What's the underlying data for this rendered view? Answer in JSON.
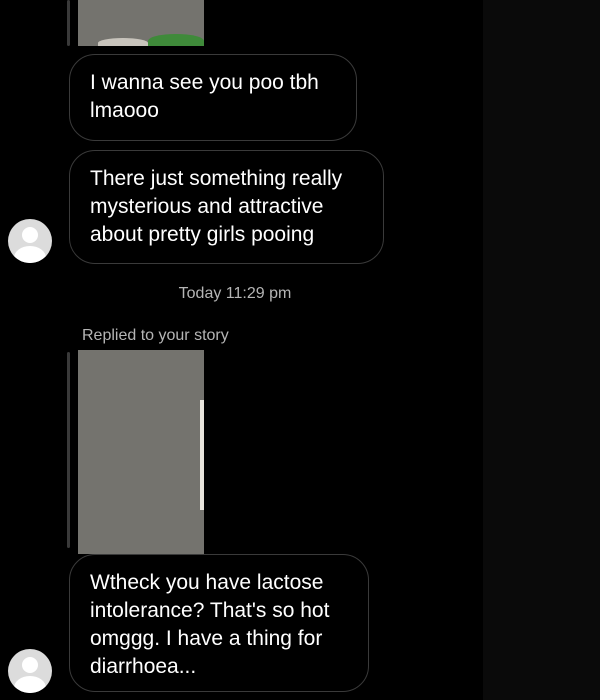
{
  "colors": {
    "background": "#000000",
    "bubble_border": "#3a3a3a",
    "text": "#ffffff",
    "meta_text": "#b5b5b5",
    "story_placeholder": "#74736e"
  },
  "messages": [
    {
      "lines": [
        "I wanna see you poo tbh",
        "lmaooo"
      ]
    },
    {
      "lines": [
        "There just something really",
        "mysterious and attractive",
        "about pretty girls pooing"
      ]
    }
  ],
  "divider": {
    "timestamp": "Today 11:29 pm"
  },
  "story_reply": {
    "label": "Replied to your story",
    "message_lines": [
      "Wtheck you have lactose",
      "intolerance? That's so hot",
      "omggg. I have a thing for",
      "diarrhoea..."
    ]
  },
  "icons": {
    "avatar": "person-avatar-icon"
  }
}
